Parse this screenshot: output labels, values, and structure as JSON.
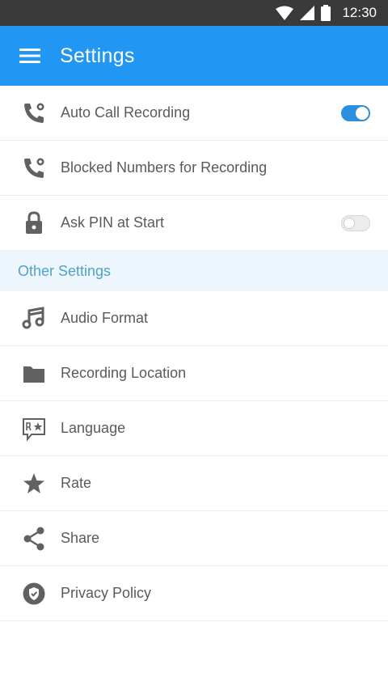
{
  "status_bar": {
    "time": "12:30",
    "icons": [
      "wifi-icon",
      "signal-icon",
      "battery-icon"
    ]
  },
  "app_bar": {
    "title": "Settings",
    "menu_icon": "menu-icon"
  },
  "colors": {
    "primary": "#2196f3",
    "section_text": "#4fa3c7",
    "section_bg": "#eef6fd",
    "icon": "#616161"
  },
  "settings": [
    {
      "label": "Auto Call Recording",
      "icon": "phone-record-icon",
      "toggle": true
    },
    {
      "label": "Blocked Numbers for Recording",
      "icon": "phone-blocked-icon"
    },
    {
      "label": "Ask PIN at Start",
      "icon": "lock-icon",
      "toggle": false
    }
  ],
  "other_section": {
    "header": "Other Settings"
  },
  "other_settings": [
    {
      "label": "Audio Format",
      "icon": "music-note-icon"
    },
    {
      "label": "Recording Location",
      "icon": "folder-icon"
    },
    {
      "label": "Language",
      "icon": "translate-icon"
    },
    {
      "label": "Rate",
      "icon": "star-icon"
    },
    {
      "label": "Share",
      "icon": "share-icon"
    },
    {
      "label": "Privacy Policy",
      "icon": "privacy-shield-icon"
    }
  ]
}
